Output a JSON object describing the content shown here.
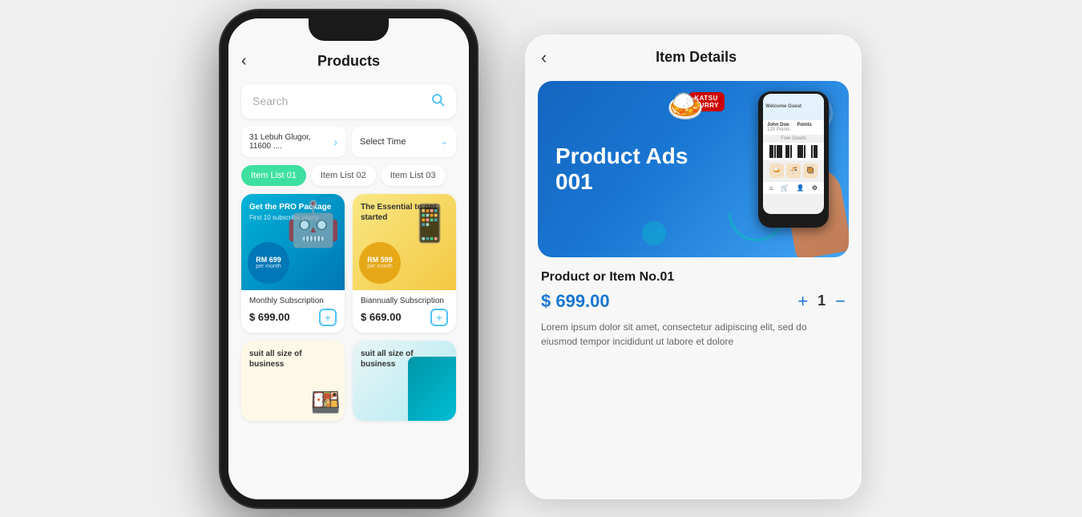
{
  "page": {
    "bg_color": "#e8e8e8"
  },
  "phone1": {
    "header": {
      "back_label": "‹",
      "title": "Products"
    },
    "search": {
      "placeholder": "Search"
    },
    "location": {
      "address": "31 Lebuh Glugor, 11600 ....",
      "time_label": "Select Time"
    },
    "tabs": [
      {
        "label": "Item List 01",
        "active": true
      },
      {
        "label": "Item List 02",
        "active": false
      },
      {
        "label": "Item List 03",
        "active": false
      }
    ],
    "products": [
      {
        "banner_type": "blue",
        "banner_title": "Get the PRO Package",
        "banner_subtitle": "First 10 subscribe yearly",
        "price_label": "RM 699",
        "per_label": "per month",
        "name": "Monthly Subscription",
        "price": "$ 699.00"
      },
      {
        "banner_type": "yellow",
        "banner_title": "The Essential to get started",
        "price_label": "RM 599",
        "per_label": "per month",
        "name": "Biannually Subscription",
        "price": "$ 669.00"
      },
      {
        "banner_type": "cream",
        "banner_title": "suit all size of business",
        "name": "",
        "price": ""
      },
      {
        "banner_type": "teal",
        "banner_title": "suit all size of business",
        "name": "",
        "price": ""
      }
    ]
  },
  "phone2": {
    "header": {
      "back_label": "‹",
      "title": "Item Details"
    },
    "banner": {
      "ad_title": "Product Ads",
      "ad_number": "001"
    },
    "item": {
      "name": "Product or Item No.01",
      "price": "$ 699.00",
      "quantity": "1",
      "description": "Lorem ipsum dolor sit amet, consectetur adipiscing elit, sed do eiusmod tempor incididunt ut labore et dolore"
    },
    "qty_plus": "+",
    "qty_minus": "−"
  }
}
